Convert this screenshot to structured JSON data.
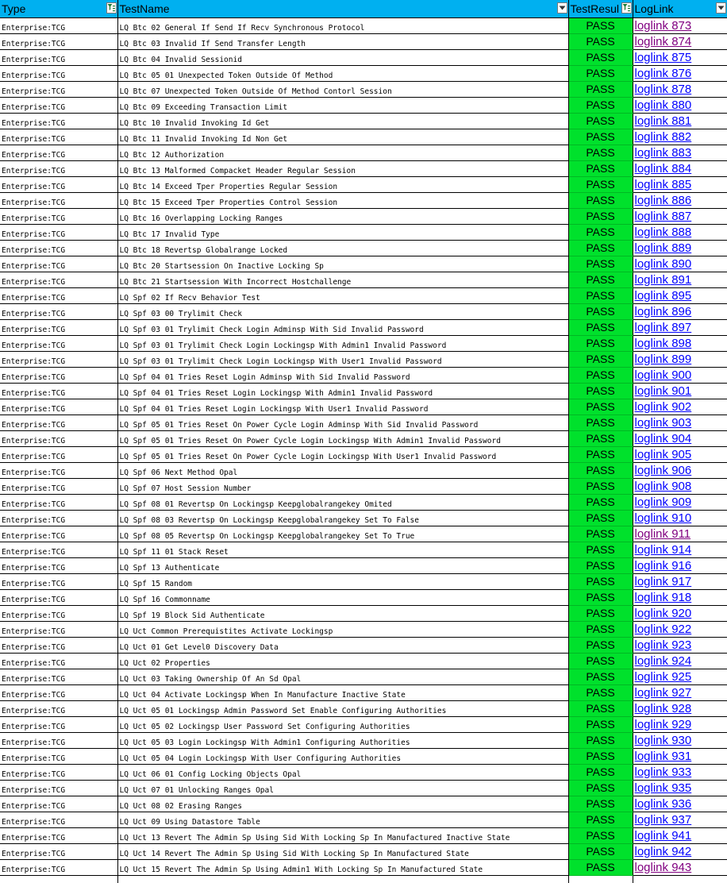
{
  "header": {
    "type": "Type",
    "test_name": "TestName",
    "test_result": "TestResul",
    "log_link": "LogLink"
  },
  "colors": {
    "header_bg": "#00b0f0",
    "pass_bg": "#00e12c",
    "link": "#0000ff",
    "link_visited": "#800080"
  },
  "rows": [
    {
      "type": "Enterprise:TCG",
      "name": "LQ Btc 02 General If Send If Recv Synchronous Protocol",
      "result": "PASS",
      "link": "loglink 873",
      "visited": true
    },
    {
      "type": "Enterprise:TCG",
      "name": "LQ Btc 03 Invalid If Send Transfer Length",
      "result": "PASS",
      "link": "loglink 874",
      "visited": true
    },
    {
      "type": "Enterprise:TCG",
      "name": "LQ Btc 04 Invalid Sessionid",
      "result": "PASS",
      "link": "loglink 875",
      "visited": false
    },
    {
      "type": "Enterprise:TCG",
      "name": "LQ Btc 05 01 Unexpected Token Outside Of Method",
      "result": "PASS",
      "link": "loglink 876",
      "visited": false
    },
    {
      "type": "Enterprise:TCG",
      "name": "LQ Btc 07 Unexpected Token Outside Of Method Contorl Session",
      "result": "PASS",
      "link": "loglink 878",
      "visited": false
    },
    {
      "type": "Enterprise:TCG",
      "name": "LQ Btc 09 Exceeding Transaction Limit",
      "result": "PASS",
      "link": "loglink 880",
      "visited": false
    },
    {
      "type": "Enterprise:TCG",
      "name": "LQ Btc 10 Invalid Invoking Id Get",
      "result": "PASS",
      "link": "loglink 881",
      "visited": false
    },
    {
      "type": "Enterprise:TCG",
      "name": "LQ Btc 11 Invalid Invoking Id Non Get",
      "result": "PASS",
      "link": "loglink 882",
      "visited": false
    },
    {
      "type": "Enterprise:TCG",
      "name": "LQ Btc 12 Authorization",
      "result": "PASS",
      "link": "loglink 883",
      "visited": false
    },
    {
      "type": "Enterprise:TCG",
      "name": "LQ Btc 13 Malformed Compacket Header Regular Session",
      "result": "PASS",
      "link": "loglink 884",
      "visited": false
    },
    {
      "type": "Enterprise:TCG",
      "name": "LQ Btc 14 Exceed Tper Properties Regular Session",
      "result": "PASS",
      "link": "loglink 885",
      "visited": false
    },
    {
      "type": "Enterprise:TCG",
      "name": "LQ Btc 15 Exceed Tper Properties Control Session",
      "result": "PASS",
      "link": "loglink 886",
      "visited": false
    },
    {
      "type": "Enterprise:TCG",
      "name": "LQ Btc 16 Overlapping Locking Ranges",
      "result": "PASS",
      "link": "loglink 887",
      "visited": false
    },
    {
      "type": "Enterprise:TCG",
      "name": "LQ Btc 17 Invalid Type",
      "result": "PASS",
      "link": "loglink 888",
      "visited": false
    },
    {
      "type": "Enterprise:TCG",
      "name": "LQ Btc 18 Revertsp Globalrange Locked",
      "result": "PASS",
      "link": "loglink 889",
      "visited": false
    },
    {
      "type": "Enterprise:TCG",
      "name": "LQ Btc 20 Startsession On Inactive Locking Sp",
      "result": "PASS",
      "link": "loglink 890",
      "visited": false
    },
    {
      "type": "Enterprise:TCG",
      "name": "LQ Btc 21 Startsession With Incorrect Hostchallenge",
      "result": "PASS",
      "link": "loglink 891",
      "visited": false
    },
    {
      "type": "Enterprise:TCG",
      "name": "LQ Spf 02 If Recv Behavior Test",
      "result": "PASS",
      "link": "loglink 895",
      "visited": false
    },
    {
      "type": "Enterprise:TCG",
      "name": "LQ Spf 03 00 Trylimit Check",
      "result": "PASS",
      "link": "loglink 896",
      "visited": false
    },
    {
      "type": "Enterprise:TCG",
      "name": "LQ Spf 03 01 Trylimit Check Login Adminsp With Sid Invalid Password",
      "result": "PASS",
      "link": "loglink 897",
      "visited": false
    },
    {
      "type": "Enterprise:TCG",
      "name": "LQ Spf 03 01 Trylimit Check Login Lockingsp With Admin1 Invalid Password",
      "result": "PASS",
      "link": "loglink 898",
      "visited": false
    },
    {
      "type": "Enterprise:TCG",
      "name": "LQ Spf 03 01 Trylimit Check Login Lockingsp With User1 Invalid Password",
      "result": "PASS",
      "link": "loglink 899",
      "visited": false
    },
    {
      "type": "Enterprise:TCG",
      "name": "LQ Spf 04 01 Tries Reset Login Adminsp With Sid Invalid Password",
      "result": "PASS",
      "link": "loglink 900",
      "visited": false
    },
    {
      "type": "Enterprise:TCG",
      "name": "LQ Spf 04 01 Tries Reset Login Lockingsp With Admin1 Invalid Password",
      "result": "PASS",
      "link": "loglink 901",
      "visited": false
    },
    {
      "type": "Enterprise:TCG",
      "name": "LQ Spf 04 01 Tries Reset Login Lockingsp With User1 Invalid Password",
      "result": "PASS",
      "link": "loglink 902",
      "visited": false
    },
    {
      "type": "Enterprise:TCG",
      "name": "LQ Spf 05 01 Tries Reset On Power Cycle Login Adminsp With Sid Invalid Password",
      "result": "PASS",
      "link": "loglink 903",
      "visited": false
    },
    {
      "type": "Enterprise:TCG",
      "name": "LQ Spf 05 01 Tries Reset On Power Cycle Login Lockingsp With Admin1 Invalid Password",
      "result": "PASS",
      "link": "loglink 904",
      "visited": false
    },
    {
      "type": "Enterprise:TCG",
      "name": "LQ Spf 05 01 Tries Reset On Power Cycle Login Lockingsp With User1 Invalid Password",
      "result": "PASS",
      "link": "loglink 905",
      "visited": false
    },
    {
      "type": "Enterprise:TCG",
      "name": "LQ Spf 06 Next Method Opal",
      "result": "PASS",
      "link": "loglink 906",
      "visited": false
    },
    {
      "type": "Enterprise:TCG",
      "name": "LQ Spf 07 Host Session Number",
      "result": "PASS",
      "link": "loglink 908",
      "visited": false
    },
    {
      "type": "Enterprise:TCG",
      "name": "LQ Spf 08 01 Revertsp On Lockingsp Keepglobalrangekey Omited",
      "result": "PASS",
      "link": "loglink 909",
      "visited": false
    },
    {
      "type": "Enterprise:TCG",
      "name": "LQ Spf 08 03 Revertsp On Lockingsp Keepglobalrangekey Set To False",
      "result": "PASS",
      "link": "loglink 910",
      "visited": false
    },
    {
      "type": "Enterprise:TCG",
      "name": "LQ Spf 08 05 Revertsp On Lockingsp Keepglobalrangekey Set To True",
      "result": "PASS",
      "link": "loglink 911",
      "visited": true
    },
    {
      "type": "Enterprise:TCG",
      "name": "LQ Spf 11 01 Stack Reset",
      "result": "PASS",
      "link": "loglink 914",
      "visited": false
    },
    {
      "type": "Enterprise:TCG",
      "name": "LQ Spf 13 Authenticate",
      "result": "PASS",
      "link": "loglink 916",
      "visited": false
    },
    {
      "type": "Enterprise:TCG",
      "name": "LQ Spf 15 Random",
      "result": "PASS",
      "link": "loglink 917",
      "visited": false
    },
    {
      "type": "Enterprise:TCG",
      "name": "LQ Spf 16 Commonname",
      "result": "PASS",
      "link": "loglink 918",
      "visited": false
    },
    {
      "type": "Enterprise:TCG",
      "name": "LQ Spf 19 Block Sid Authenticate",
      "result": "PASS",
      "link": "loglink 920",
      "visited": false
    },
    {
      "type": "Enterprise:TCG",
      "name": "LQ Uct Common Prerequistites Activate Lockingsp",
      "result": "PASS",
      "link": "loglink 922",
      "visited": false
    },
    {
      "type": "Enterprise:TCG",
      "name": "LQ Uct 01 Get Level0 Discovery Data",
      "result": "PASS",
      "link": "loglink 923",
      "visited": false
    },
    {
      "type": "Enterprise:TCG",
      "name": "LQ Uct 02 Properties",
      "result": "PASS",
      "link": "loglink 924",
      "visited": false
    },
    {
      "type": "Enterprise:TCG",
      "name": "LQ Uct 03 Taking Ownership Of An Sd Opal",
      "result": "PASS",
      "link": "loglink 925",
      "visited": false
    },
    {
      "type": "Enterprise:TCG",
      "name": "LQ Uct 04 Activate Lockingsp When In Manufacture Inactive State",
      "result": "PASS",
      "link": "loglink 927",
      "visited": false
    },
    {
      "type": "Enterprise:TCG",
      "name": "LQ Uct 05 01 Lockingsp Admin Password Set Enable Configuring Authorities",
      "result": "PASS",
      "link": "loglink 928",
      "visited": false
    },
    {
      "type": "Enterprise:TCG",
      "name": "LQ Uct 05 02 Lockingsp User Password Set Configuring Authorities",
      "result": "PASS",
      "link": "loglink 929",
      "visited": false
    },
    {
      "type": "Enterprise:TCG",
      "name": "LQ Uct 05 03 Login Lockingsp With Admin1 Configuring Authorities",
      "result": "PASS",
      "link": "loglink 930",
      "visited": false
    },
    {
      "type": "Enterprise:TCG",
      "name": "LQ Uct 05 04 Login Lockingsp With User Configuring Authorities",
      "result": "PASS",
      "link": "loglink 931",
      "visited": false
    },
    {
      "type": "Enterprise:TCG",
      "name": "LQ Uct 06 01 Config Locking Objects Opal",
      "result": "PASS",
      "link": "loglink 933",
      "visited": false
    },
    {
      "type": "Enterprise:TCG",
      "name": "LQ Uct 07 01 Unlocking Ranges Opal",
      "result": "PASS",
      "link": "loglink 935",
      "visited": false
    },
    {
      "type": "Enterprise:TCG",
      "name": "LQ Uct 08 02 Erasing Ranges",
      "result": "PASS",
      "link": "loglink 936",
      "visited": false
    },
    {
      "type": "Enterprise:TCG",
      "name": "LQ Uct 09 Using Datastore Table",
      "result": "PASS",
      "link": "loglink 937",
      "visited": false
    },
    {
      "type": "Enterprise:TCG",
      "name": "LQ Uct 13 Revert The Admin Sp Using Sid With Locking Sp In Manufactured Inactive State",
      "result": "PASS",
      "link": "loglink 941",
      "visited": false
    },
    {
      "type": "Enterprise:TCG",
      "name": "LQ Uct 14 Revert The Admin Sp Using Sid With Locking Sp In Manufactured State",
      "result": "PASS",
      "link": "loglink 942",
      "visited": false
    },
    {
      "type": "Enterprise:TCG",
      "name": "LQ Uct 15 Revert The Admin Sp Using Admin1 With Locking Sp In Manufactured State",
      "result": "PASS",
      "link": "loglink 943",
      "visited": true
    }
  ]
}
